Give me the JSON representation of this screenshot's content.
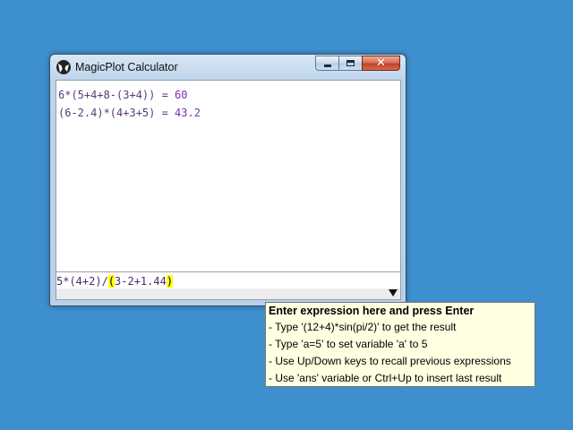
{
  "window": {
    "title": "MagicPlot Calculator",
    "buttons": {
      "minimize": "minimize",
      "maximize": "maximize",
      "close": "✕"
    }
  },
  "history": [
    {
      "expression": "6*(5+4+8-(3+4)) = ",
      "result": "60"
    },
    {
      "expression": "(6-2.4)*(4+3+5) = ",
      "result": "43.2"
    }
  ],
  "input": {
    "prefix": "5*(4+2)/",
    "open_paren": "(",
    "middle": "3-2+1.44",
    "close_paren": ")"
  },
  "tooltip": {
    "title": "Enter expression here and press Enter",
    "lines": [
      "- Type '(12+4)*sin(pi/2)' to get the result",
      "- Type 'a=5' to set variable 'a' to 5",
      "- Use Up/Down keys to recall previous expressions",
      "- Use 'ans' variable or Ctrl+Up to insert last result"
    ]
  },
  "colors": {
    "desktop": "#3d8fcd",
    "paren_highlight": "#ffff00",
    "tooltip_bg": "#ffffe1"
  },
  "icons": {
    "app": "magicplot-icon",
    "status": "triangle-down-icon"
  }
}
